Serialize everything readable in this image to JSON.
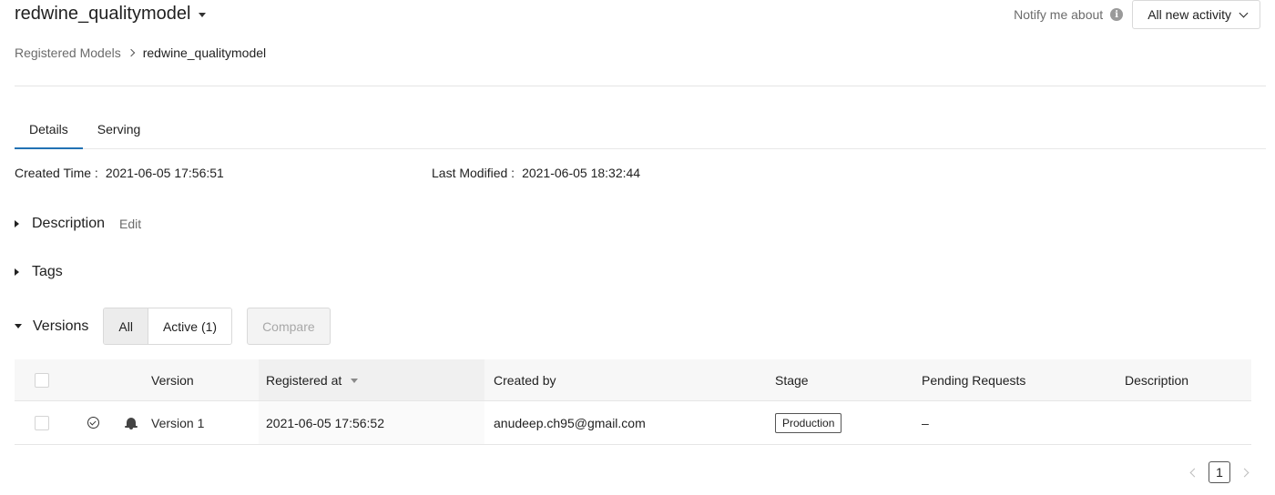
{
  "header": {
    "title": "redwine_qualitymodel",
    "notify_label": "Notify me about",
    "activity_select": "All new activity"
  },
  "breadcrumb": {
    "parent": "Registered Models",
    "current": "redwine_qualitymodel"
  },
  "tabs": [
    {
      "label": "Details",
      "active": true
    },
    {
      "label": "Serving",
      "active": false
    }
  ],
  "meta": {
    "created_label": "Created Time :",
    "created_value": "2021-06-05 17:56:51",
    "modified_label": "Last Modified :",
    "modified_value": "2021-06-05 18:32:44"
  },
  "sections": {
    "description": "Description",
    "edit": "Edit",
    "tags": "Tags",
    "versions": "Versions"
  },
  "version_filter": {
    "all": "All",
    "active": "Active (1)",
    "compare": "Compare"
  },
  "table": {
    "columns": [
      "Version",
      "Registered at",
      "Created by",
      "Stage",
      "Pending Requests",
      "Description"
    ],
    "rows": [
      {
        "version": "Version 1",
        "registered_at": "2021-06-05 17:56:52",
        "created_by": "anudeep.ch95@gmail.com",
        "stage": "Production",
        "pending_requests": "–",
        "description": ""
      }
    ]
  },
  "pagination": {
    "current_page": "1"
  },
  "icons": {
    "title_caret": "caret-down-icon",
    "info": "info-icon",
    "select_chevron": "chevron-down-icon",
    "breadcrumb_sep": "chevron-right-icon",
    "row_status": "check-circle-icon",
    "row_notify": "bell-icon"
  }
}
